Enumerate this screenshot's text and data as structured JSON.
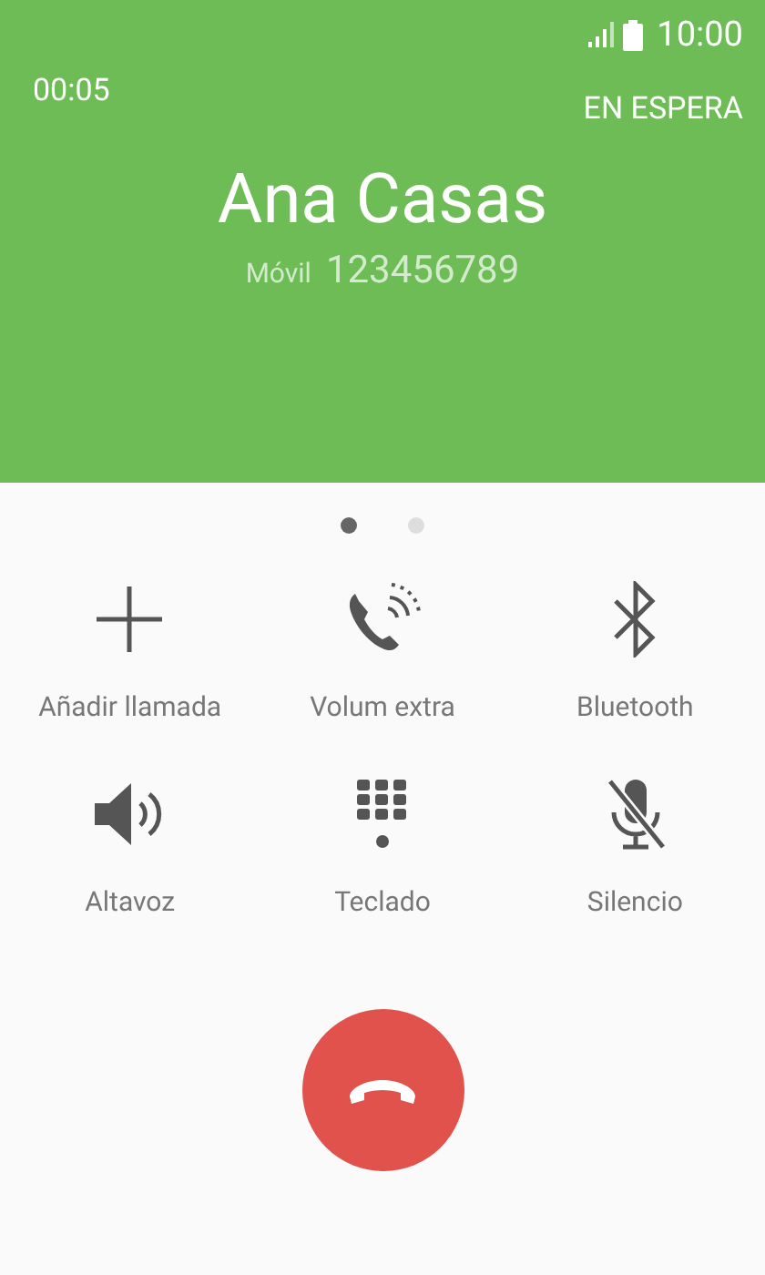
{
  "status_bar": {
    "time": "10:00"
  },
  "call": {
    "duration": "00:05",
    "hold_label": "EN ESPERA",
    "name": "Ana Casas",
    "number_type": "Móvil",
    "number": "123456789"
  },
  "pages": [
    {
      "selected": true
    },
    {
      "selected": false
    }
  ],
  "actions": [
    {
      "kind": "add",
      "label": "Añadir llamada"
    },
    {
      "kind": "volume",
      "label": "Volum extra"
    },
    {
      "kind": "bluetooth",
      "label": "Bluetooth"
    },
    {
      "kind": "speaker",
      "label": "Altavoz"
    },
    {
      "kind": "keypad",
      "label": "Teclado"
    },
    {
      "kind": "mute",
      "label": "Silencio"
    }
  ]
}
